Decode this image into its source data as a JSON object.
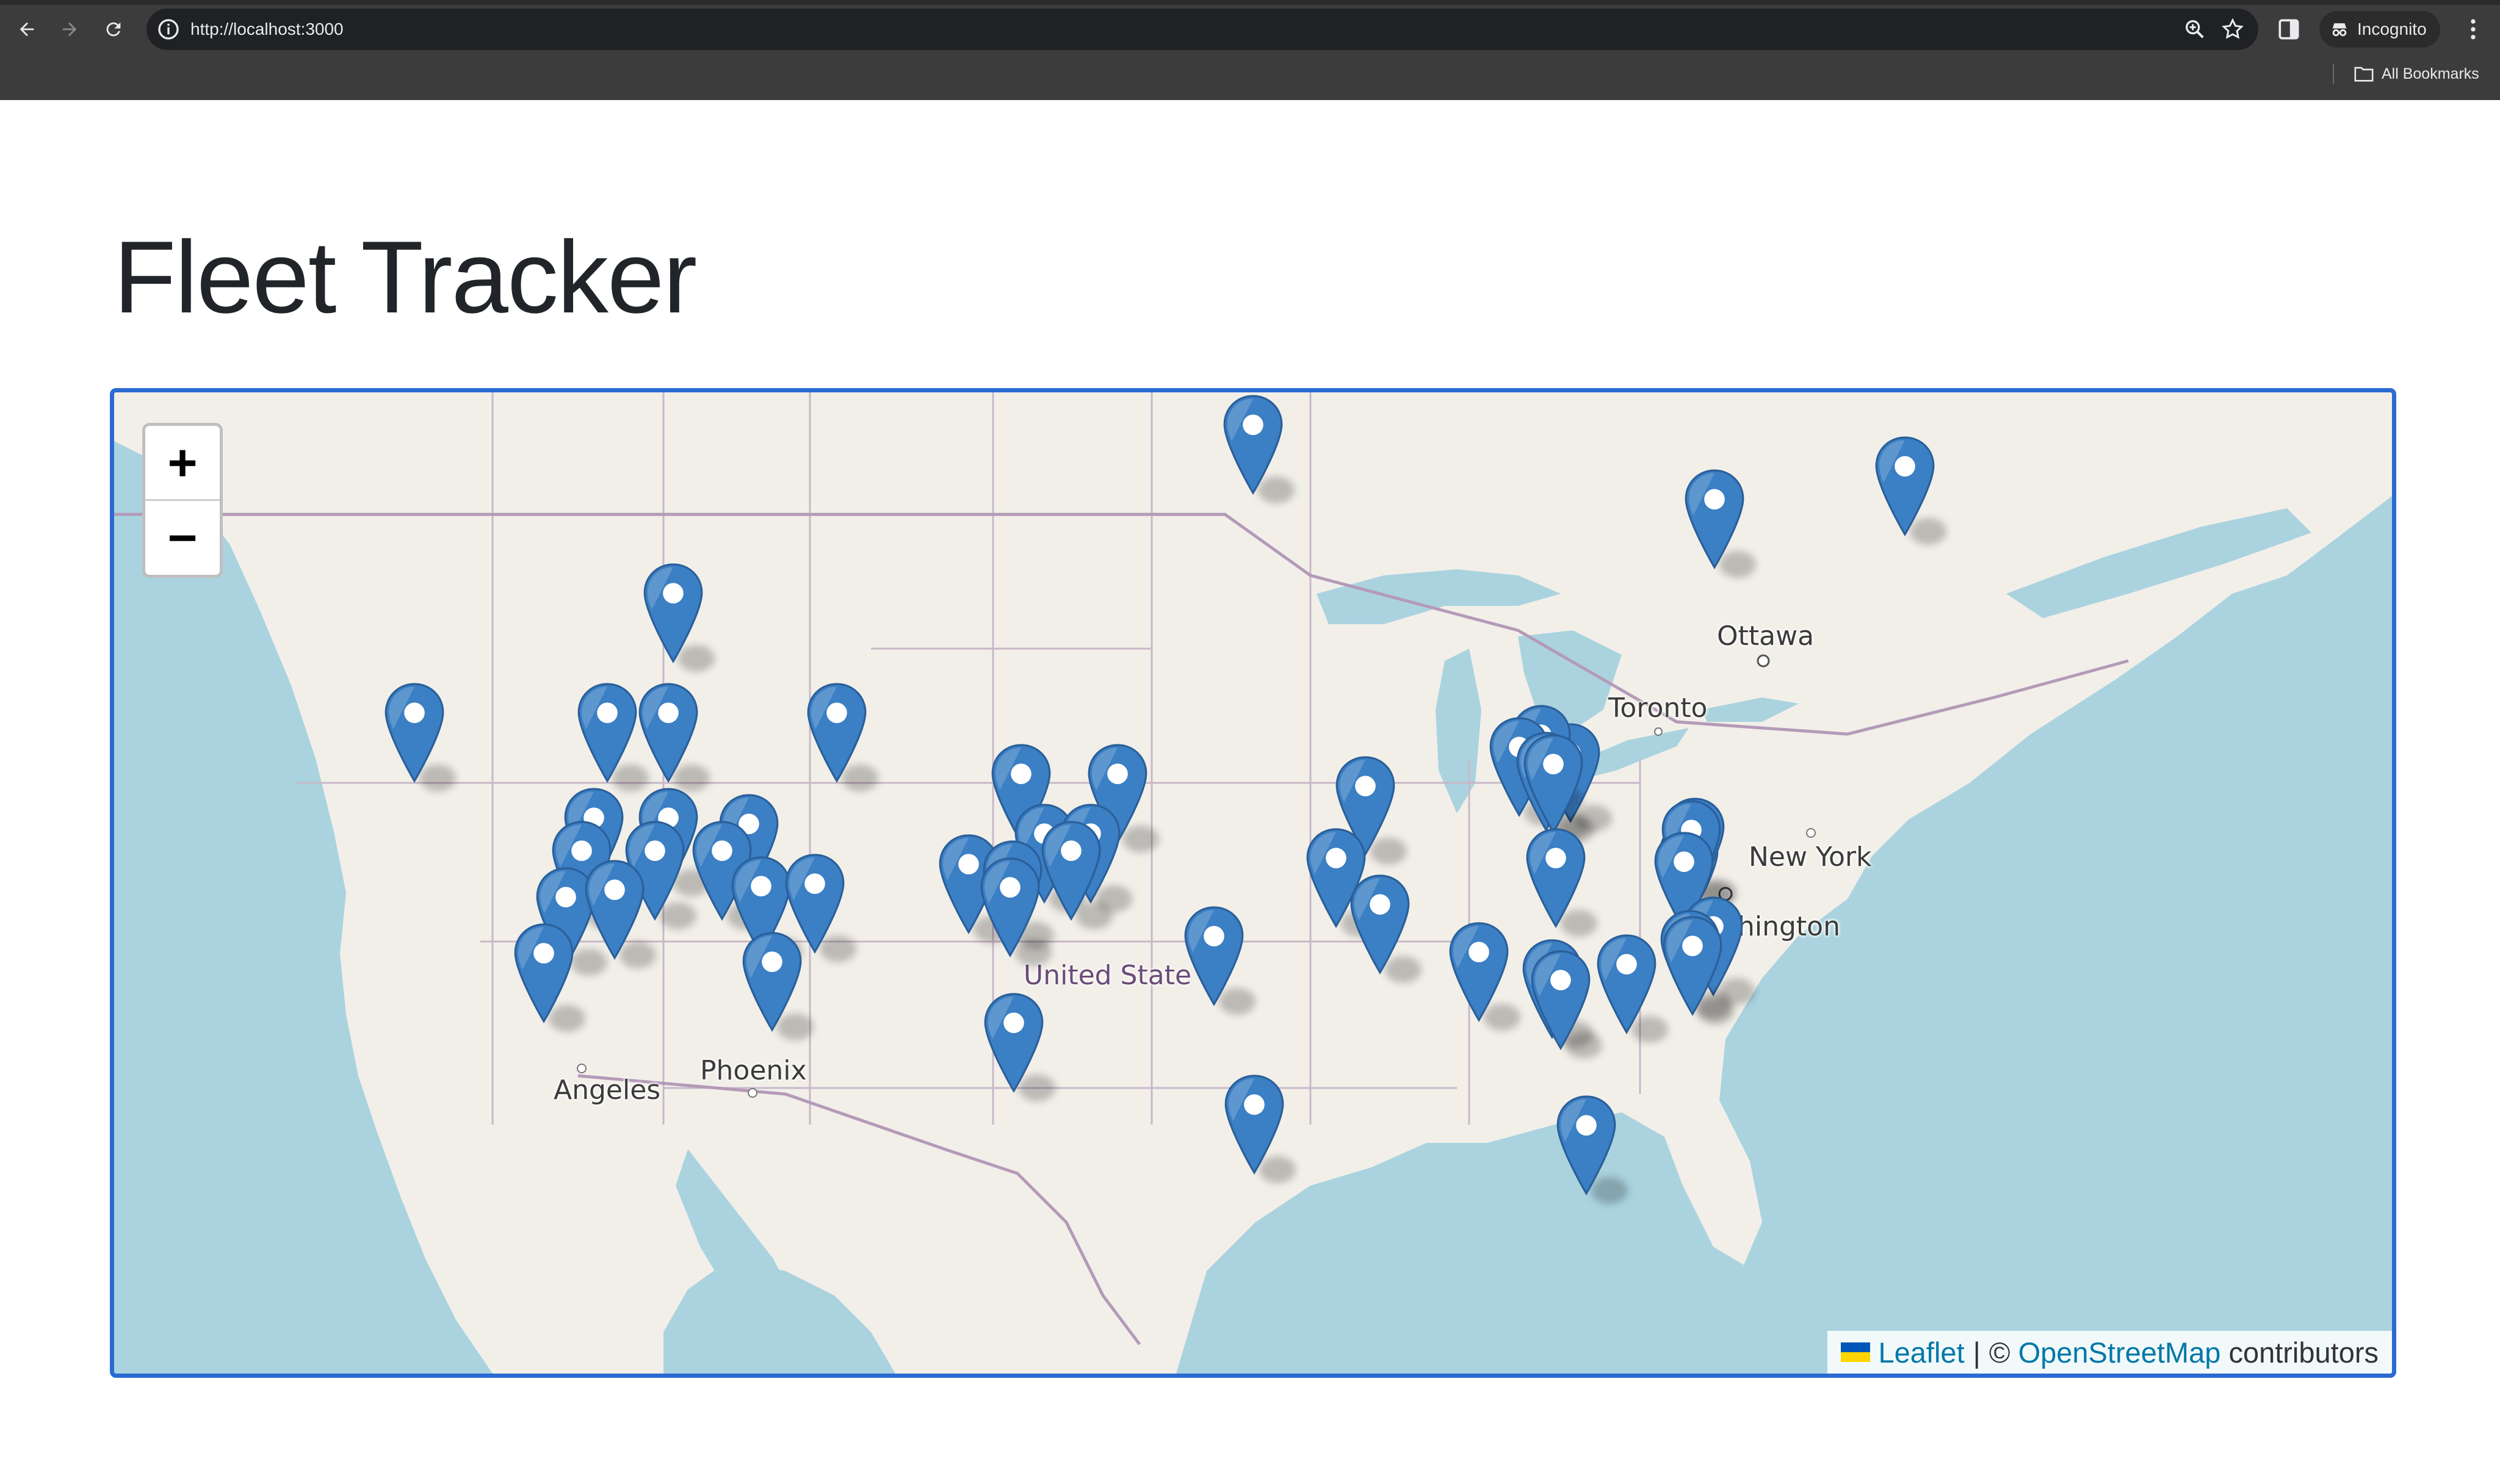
{
  "browser": {
    "url": "http://localhost:3000",
    "profile_label": "Incognito",
    "bookmarks_label": "All Bookmarks",
    "icons": [
      "back-arrow-icon",
      "forward-arrow-icon",
      "reload-icon",
      "site-info-icon",
      "zoom-icon",
      "bookmark-star-icon",
      "side-panel-icon",
      "incognito-icon",
      "menu-kebab-icon",
      "folder-icon"
    ]
  },
  "page": {
    "title": "Fleet Tracker"
  },
  "map": {
    "zoom_in_label": "+",
    "zoom_out_label": "−",
    "attribution": {
      "leaflet": "Leaflet",
      "separator": "|",
      "copyright": "©",
      "osm": "OpenStreetMap",
      "suffix": "contributors"
    },
    "labels": {
      "ottawa": "Ottawa",
      "toronto": "Toronto",
      "new_york": "New York",
      "washington": "hington",
      "los_angeles": "Angeles",
      "phoenix": "Phoenix",
      "country": "United State"
    },
    "marker_color": "#3b7fc4",
    "vehicle_count": 52
  }
}
